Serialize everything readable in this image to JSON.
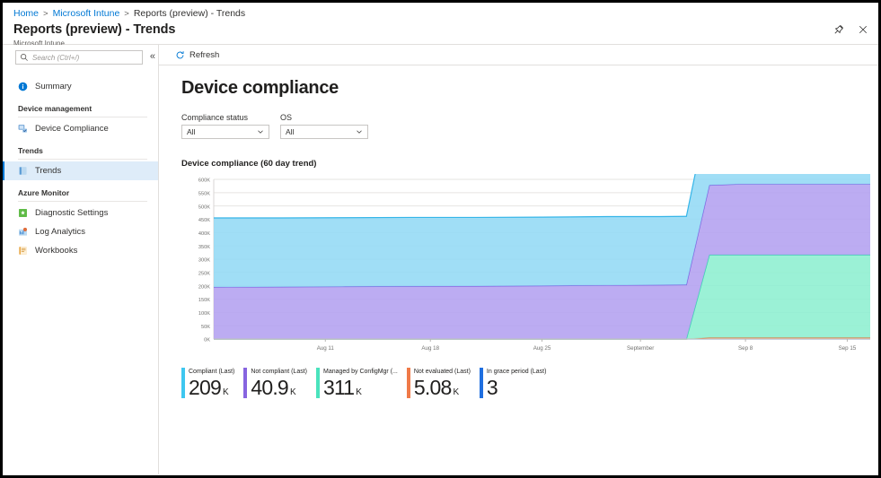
{
  "breadcrumb": {
    "items": [
      {
        "label": "Home",
        "link": true
      },
      {
        "label": "Microsoft Intune",
        "link": true
      },
      {
        "label": "Reports (preview) - Trends",
        "link": false
      }
    ],
    "separator": ">"
  },
  "header": {
    "title": "Reports (preview) - Trends",
    "subtitle": "Microsoft Intune",
    "pin_icon": "pin-icon",
    "close_icon": "close-icon"
  },
  "sidebar": {
    "search": {
      "placeholder": "Search (Ctrl+/)",
      "value": "",
      "icon": "search-icon"
    },
    "collapse_glyph": "«",
    "items": [
      {
        "label": "Summary",
        "icon": "info-icon",
        "type": "item",
        "selected": false,
        "color": "#0078d4"
      },
      {
        "label": "Device management",
        "type": "group"
      },
      {
        "label": "Device Compliance",
        "icon": "device-compliance-icon",
        "type": "item",
        "selected": false,
        "color": "#3b7fc4"
      },
      {
        "label": "Trends",
        "type": "group"
      },
      {
        "label": "Trends",
        "icon": "trends-icon",
        "type": "item",
        "selected": true,
        "color": "#5b9bd5"
      },
      {
        "label": "Azure Monitor",
        "type": "group"
      },
      {
        "label": "Diagnostic Settings",
        "icon": "diagnostic-settings-icon",
        "type": "item",
        "selected": false,
        "color": "#5fbb46"
      },
      {
        "label": "Log Analytics",
        "icon": "log-analytics-icon",
        "type": "item",
        "selected": false,
        "color": "#4a8fd4"
      },
      {
        "label": "Workbooks",
        "icon": "workbooks-icon",
        "type": "item",
        "selected": false,
        "color": "#e8a33d"
      }
    ]
  },
  "command_bar": {
    "refresh_label": "Refresh",
    "refresh_icon": "refresh-icon"
  },
  "main": {
    "page_heading": "Device compliance",
    "filters": [
      {
        "label": "Compliance status",
        "value": "All",
        "name": "compliance-status-select"
      },
      {
        "label": "OS",
        "value": "All",
        "name": "os-select"
      }
    ],
    "chart_card_title": "Device compliance (60 day trend)"
  },
  "kpis": [
    {
      "label": "Compliant (Last)",
      "value": "209",
      "unit": "K",
      "color": "#3ec7f0"
    },
    {
      "label": "Not compliant (Last)",
      "value": "40.9",
      "unit": "K",
      "color": "#8764e0"
    },
    {
      "label": "Managed by ConfigMgr (...",
      "value": "311",
      "unit": "K",
      "color": "#4ae3bd"
    },
    {
      "label": "Not evaluated (Last)",
      "value": "5.08",
      "unit": "K",
      "color": "#f07a48"
    },
    {
      "label": "In grace period (Last)",
      "value": "3",
      "unit": "",
      "color": "#1f6fe0"
    }
  ],
  "chart_data": {
    "type": "area",
    "stacked": true,
    "title": "Device compliance (60 day trend)",
    "xlabel": "",
    "ylabel": "",
    "ylim": [
      0,
      600000
    ],
    "grid": true,
    "legend_position": "bottom",
    "ytick_labels": [
      "600K",
      "550K",
      "500K",
      "450K",
      "400K",
      "350K",
      "300K",
      "250K",
      "200K",
      "150K",
      "100K",
      "50K",
      "0K"
    ],
    "ytick_values": [
      600000,
      550000,
      500000,
      450000,
      400000,
      350000,
      300000,
      250000,
      200000,
      150000,
      100000,
      50000,
      0
    ],
    "xtick_labels": [
      "Aug 11",
      "Aug 18",
      "Aug 25",
      "September",
      "Sep 8",
      "Sep 15"
    ],
    "xtick_positions": [
      0.17,
      0.33,
      0.5,
      0.65,
      0.81,
      0.965
    ],
    "x": [
      0,
      0.1,
      0.2,
      0.3,
      0.4,
      0.5,
      0.6,
      0.68,
      0.72,
      0.755,
      0.8,
      0.88,
      1.0
    ],
    "series": [
      {
        "name": "Not compliant",
        "color": "#b3a1f0",
        "line_color": "#7d5fe0",
        "values": [
          195000,
          196000,
          197000,
          198000,
          199000,
          200000,
          202000,
          203000,
          204000,
          262000,
          266000,
          266000,
          266000
        ]
      },
      {
        "name": "Compliant",
        "color": "#93daf5",
        "line_color": "#35b5e8",
        "values": [
          260000,
          259000,
          259000,
          259000,
          258000,
          258000,
          258000,
          257000,
          257000,
          300000,
          300000,
          300000,
          300000
        ]
      },
      {
        "name": "Managed by ConfigMgr",
        "color": "#8defd0",
        "line_color": "#32d6ae",
        "values": [
          0,
          0,
          0,
          0,
          0,
          0,
          0,
          0,
          0,
          311000,
          311000,
          311000,
          311000
        ]
      },
      {
        "name": "Not evaluated",
        "color": "#f3a981",
        "line_color": "#e8763c",
        "values": [
          0,
          0,
          0,
          0,
          0,
          0,
          0,
          0,
          0,
          5080,
          5080,
          5080,
          5080
        ]
      },
      {
        "name": "In grace period",
        "color": "#1f6fe0",
        "line_color": "#1f6fe0",
        "values": [
          0,
          0,
          0,
          0,
          0,
          0,
          0,
          0,
          0,
          3,
          3,
          3,
          3
        ]
      }
    ]
  }
}
